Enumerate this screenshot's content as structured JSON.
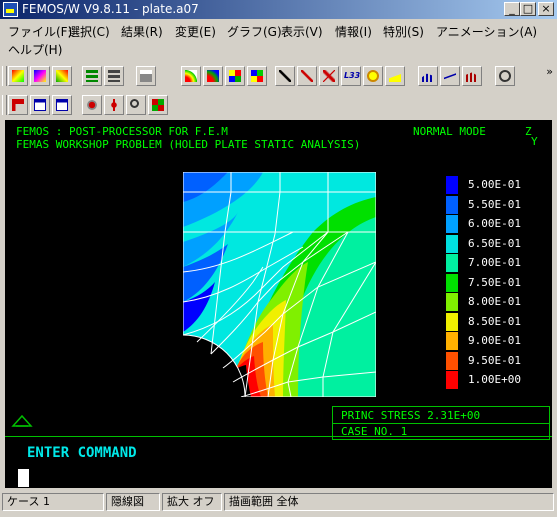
{
  "window": {
    "title": "FEMOS/W V9.8.11 - plate.a07",
    "minimize": "_",
    "maximize": "□",
    "close": "×"
  },
  "menu": [
    "ファイル(F)",
    "選択(C)",
    "結果(R)",
    "変更(E)",
    "グラフ(G)",
    "表示(V)",
    "情報(I)",
    "特別(S)",
    "アニメーション(A)",
    "ヘルプ(H)"
  ],
  "toolbar_more": "»",
  "canvas": {
    "header_left": "FEMOS  : POST-PROCESSOR  FOR F.E.M",
    "header_mode": "NORMAL MODE",
    "header_sub": "FEMAS WORKSHOP PROBLEM (HOLED PLATE STATIC ANALYSIS)",
    "axis_z": "Z",
    "axis_y": "Y",
    "legend": [
      {
        "label": "5.00E-01",
        "color": "#0000ff"
      },
      {
        "label": "5.50E-01",
        "color": "#0060ff"
      },
      {
        "label": "6.00E-01",
        "color": "#00a0ff"
      },
      {
        "label": "6.50E-01",
        "color": "#00e0e0"
      },
      {
        "label": "7.00E-01",
        "color": "#00f0a0"
      },
      {
        "label": "7.50E-01",
        "color": "#00e000"
      },
      {
        "label": "8.00E-01",
        "color": "#80f000"
      },
      {
        "label": "8.50E-01",
        "color": "#f0f000"
      },
      {
        "label": "9.00E-01",
        "color": "#ffb000"
      },
      {
        "label": "9.50E-01",
        "color": "#ff5000"
      },
      {
        "label": "1.00E+00",
        "color": "#ff0000"
      }
    ],
    "info_line1": "PRINC STRESS    2.31E+00",
    "info_line2": "CASE NO.           1",
    "command": "ENTER COMMAND"
  },
  "status": [
    "ケース 1",
    "隠線図",
    "拡大 オフ",
    "描画範囲 全体"
  ]
}
